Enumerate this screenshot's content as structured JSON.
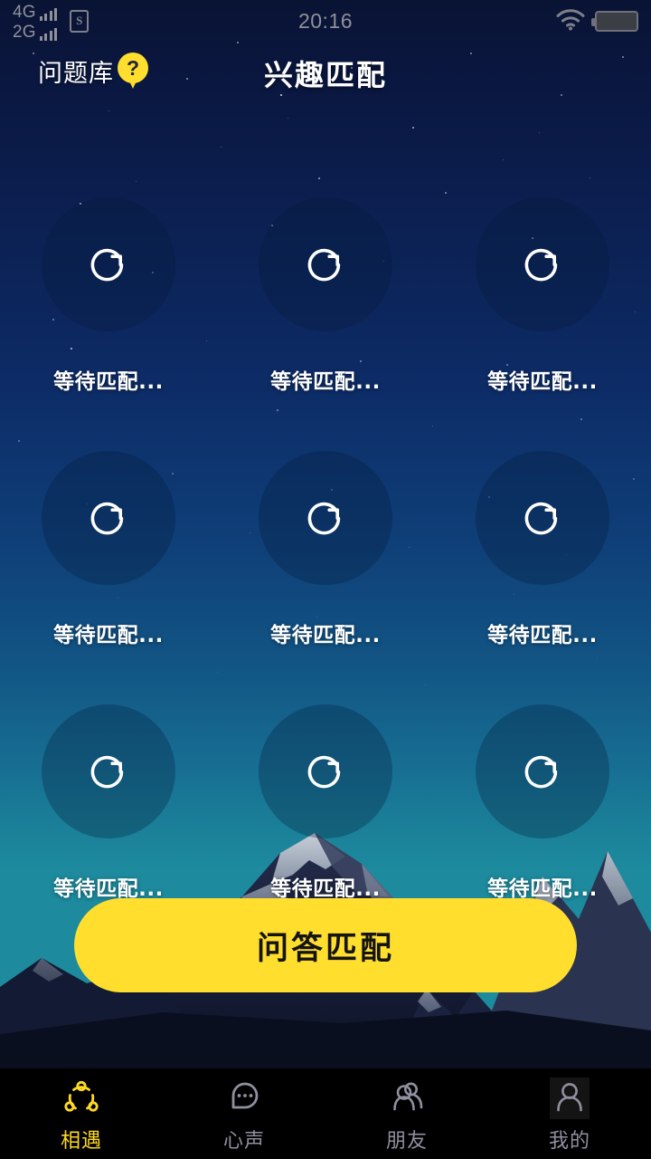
{
  "status_bar": {
    "sim1_network": "4G",
    "sim1_signal_bars": 4,
    "sim2_network": "2G",
    "sim2_signal_bars": 4,
    "sd_card_icon": "sd-card-icon",
    "sd_card_letter": "S",
    "time": "20:16",
    "wifi_icon": "wifi-icon",
    "battery_icon": "battery-icon"
  },
  "header": {
    "question_bank_label": "问题库",
    "question_bank_badge": "?",
    "title": "兴趣匹配"
  },
  "grid": {
    "slot_icon": "refresh-icon",
    "slots": [
      {
        "label": "等待匹配..."
      },
      {
        "label": "等待匹配..."
      },
      {
        "label": "等待匹配..."
      },
      {
        "label": "等待匹配..."
      },
      {
        "label": "等待匹配..."
      },
      {
        "label": "等待匹配..."
      },
      {
        "label": "等待匹配..."
      },
      {
        "label": "等待匹配..."
      },
      {
        "label": "等待匹配..."
      }
    ]
  },
  "cta": {
    "label": "问答匹配"
  },
  "tabbar": {
    "items": [
      {
        "label": "相遇",
        "icon": "connection-nodes-icon",
        "active": true
      },
      {
        "label": "心声",
        "icon": "speech-bubble-dots-icon",
        "active": false
      },
      {
        "label": "朋友",
        "icon": "two-people-icon",
        "active": false
      },
      {
        "label": "我的",
        "icon": "person-icon",
        "active": false
      }
    ]
  },
  "colors": {
    "accent_yellow": "#FFDE2E",
    "tab_active": "#FFD923",
    "tab_inactive": "#8f90a0",
    "sky_top": "#091334",
    "sky_bottom": "#1d8a9e",
    "tabbar_bg": "#000000"
  }
}
